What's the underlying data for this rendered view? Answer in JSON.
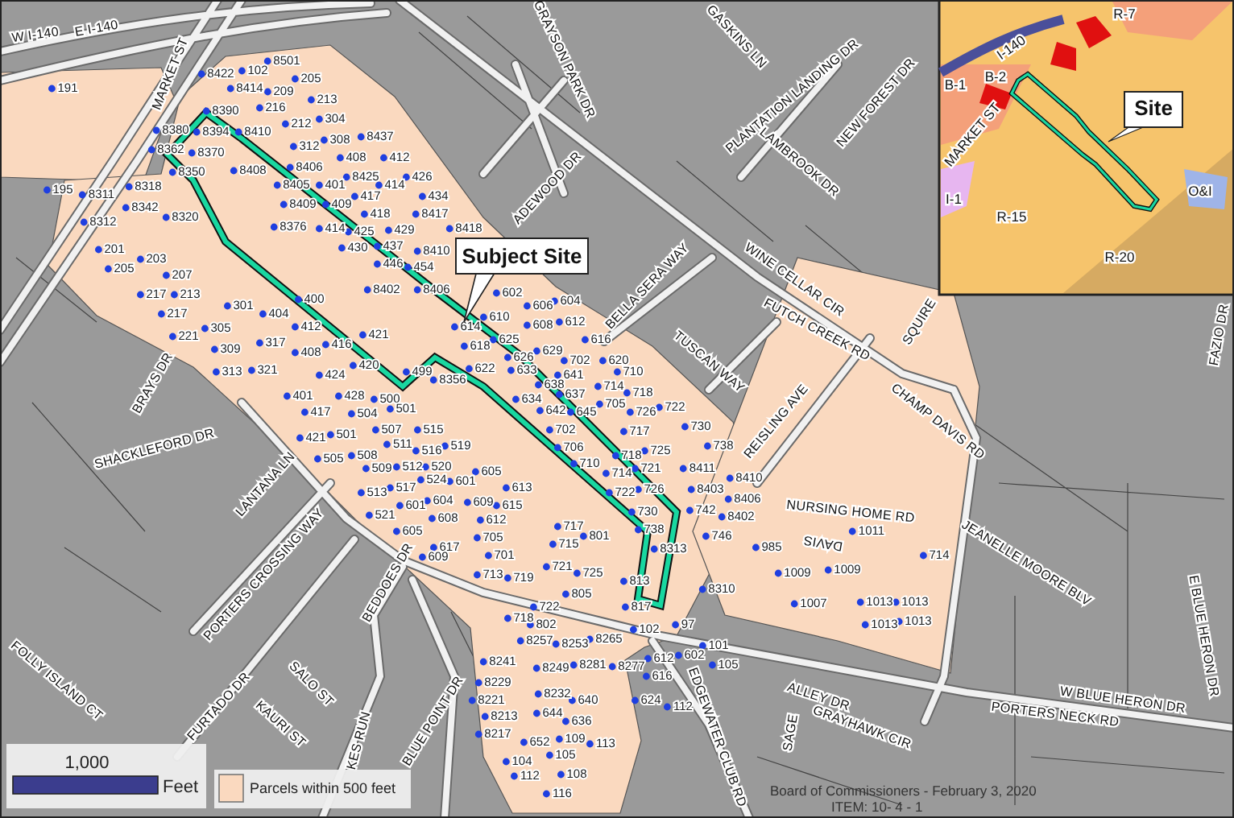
{
  "map": {
    "callout": "Subject Site",
    "streets": [
      "W I-140",
      "E I-140",
      "MARKET ST",
      "GRAYSON PARK DR",
      "GASKINS LN",
      "PLANTATION LANDING DR",
      "NEW FOREST DR",
      "LAMBROOK DR",
      "ADEWOOD DR",
      "BELLA SERA WAY",
      "WINE CELLAR CIR",
      "FUTCH CREEK RD",
      "TUSCAN WAY",
      "SQUIRE",
      "REISLING AVE",
      "CHAMP DAVIS RD",
      "NURSING HOME RD",
      "DAVIS",
      "JEANELLE MOORE BLV",
      "E BLUE HERON DR",
      "W BLUE HERON DR",
      "PORTERS NECK RD",
      "GRAYHAWK CIR",
      "ALLEY DR",
      "SAGE",
      "EDGEWATER CLUB RD",
      "FAZIO DR",
      "BRAYS DR",
      "SHACKLEFORD DR",
      "LANTANA LN",
      "PORTERS CROSSING WAY",
      "BEDDOES DR",
      "FOLLY ISLAND CT",
      "FURTADO DR",
      "SALO ST",
      "KAURI ST",
      "KES RUN",
      "BLUE POINT DR"
    ],
    "parcel_labels": [
      "191",
      "8501",
      "102",
      "8422",
      "205",
      "8414",
      "209",
      "213",
      "216",
      "8390",
      "212",
      "304",
      "8380",
      "8394",
      "8410",
      "308",
      "8437",
      "8362",
      "8370",
      "312",
      "408",
      "412",
      "8350",
      "8408",
      "8406",
      "8425",
      "426",
      "195",
      "8311",
      "8318",
      "8405",
      "401",
      "414",
      "417",
      "434",
      "8342",
      "8320",
      "8409",
      "409",
      "418",
      "8417",
      "8312",
      "8376",
      "414",
      "425",
      "429",
      "8418",
      "201",
      "430",
      "437",
      "8410",
      "203",
      "205",
      "446",
      "454",
      "207",
      "8402",
      "8406",
      "217",
      "213",
      "400",
      "301",
      "217",
      "404",
      "305",
      "412",
      "221",
      "421",
      "317",
      "416",
      "309",
      "408",
      "420",
      "313",
      "321",
      "424",
      "499",
      "8356",
      "401",
      "428",
      "500",
      "602",
      "604",
      "606",
      "610",
      "608",
      "612",
      "614",
      "618",
      "625",
      "616",
      "629",
      "626",
      "702",
      "622",
      "633",
      "641",
      "638",
      "637",
      "634",
      "620",
      "710",
      "714",
      "718",
      "417",
      "504",
      "501",
      "642",
      "645",
      "501",
      "507",
      "515",
      "702",
      "421",
      "511",
      "508",
      "516",
      "519",
      "706",
      "505",
      "509",
      "512",
      "520",
      "710",
      "605",
      "513",
      "517",
      "524",
      "601",
      "613",
      "601",
      "604",
      "609",
      "615",
      "521",
      "608",
      "612",
      "605",
      "717",
      "617",
      "705",
      "715",
      "801",
      "609",
      "701",
      "713",
      "719",
      "721",
      "725",
      "805",
      "722",
      "718",
      "802",
      "8257",
      "8253",
      "8265",
      "8241",
      "8249",
      "8281",
      "8229",
      "8221",
      "8232",
      "640",
      "8213",
      "644",
      "636",
      "8217",
      "652",
      "109",
      "113",
      "104",
      "105",
      "112",
      "108",
      "116",
      "705",
      "726",
      "722",
      "730",
      "717",
      "718",
      "725",
      "738",
      "721",
      "8411",
      "8410",
      "714",
      "722",
      "726",
      "8403",
      "8406",
      "730",
      "742",
      "8402",
      "738",
      "746",
      "8313",
      "985",
      "1011",
      "714",
      "813",
      "1009",
      "1009",
      "8310",
      "817",
      "1007",
      "1013",
      "1013",
      "102",
      "97",
      "1013",
      "1013",
      "101",
      "8277",
      "612",
      "602",
      "105",
      "616",
      "624",
      "112"
    ]
  },
  "inset": {
    "zones": [
      "R-7",
      "B-1",
      "B-2",
      "I-1",
      "R-15",
      "R-20",
      "O&I"
    ],
    "highway": "I-140",
    "street": "MARKET ST",
    "callout": "Site"
  },
  "scale_bar": {
    "distance": "1,000",
    "unit": "Feet"
  },
  "legend": {
    "label": "Parcels within 500 feet"
  },
  "footer": {
    "line_1": "Board of Commissioners - February 3, 2020",
    "line_2": "ITEM: 10- 4 - 1"
  }
}
